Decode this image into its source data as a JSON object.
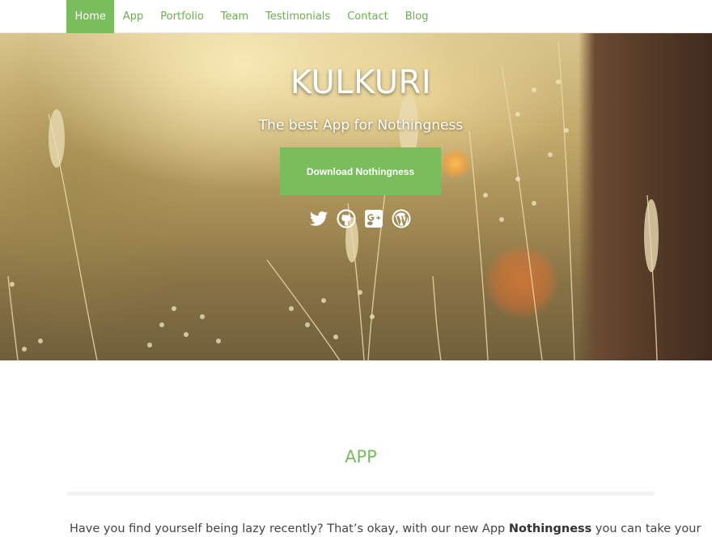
{
  "nav": {
    "items": [
      {
        "label": "Home",
        "active": true
      },
      {
        "label": "App",
        "active": false
      },
      {
        "label": "Portfolio",
        "active": false
      },
      {
        "label": "Team",
        "active": false
      },
      {
        "label": "Testimonials",
        "active": false
      },
      {
        "label": "Contact",
        "active": false
      },
      {
        "label": "Blog",
        "active": false
      }
    ]
  },
  "hero": {
    "title": "KULKURI",
    "subtitle": "The best App for Nothingness",
    "download_label": "Download Nothingness",
    "social_icons": [
      "twitter-icon",
      "github-icon",
      "google-plus-icon",
      "wordpress-icon"
    ]
  },
  "app_section": {
    "title": "APP",
    "body_before": "Have you find yourself being lazy recently? That’s okay, with our new App ",
    "body_bold": "Nothingness",
    "body_after": " you can take your"
  },
  "colors": {
    "accent": "#79bd5c",
    "nav_link": "#6ab04c",
    "body_text": "#444444"
  }
}
